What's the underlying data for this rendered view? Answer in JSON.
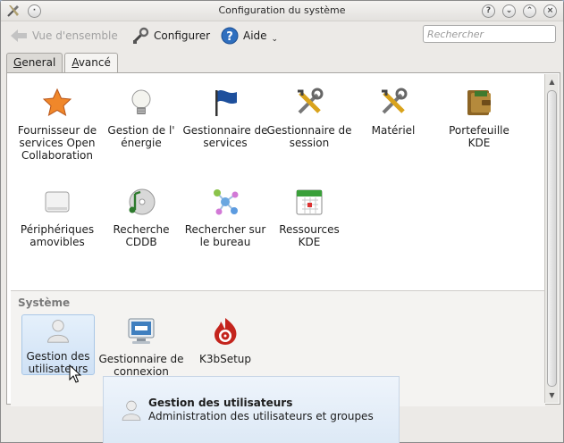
{
  "window": {
    "title": "Configuration du système"
  },
  "toolbar": {
    "overview_label": "Vue d'ensemble",
    "configure_label": "Configurer",
    "help_label": "Aide",
    "search_placeholder": "Rechercher"
  },
  "tabs": [
    {
      "label_prefix": "",
      "label_accel": "G",
      "label_rest": "eneral",
      "active": false
    },
    {
      "label_prefix": "",
      "label_accel": "A",
      "label_rest": "vancé",
      "active": true
    }
  ],
  "items": [
    {
      "label": "Fournisseur de services Open Collaboration",
      "icon": "star-icon"
    },
    {
      "label": "Gestion de l' énergie",
      "icon": "lightbulb-icon"
    },
    {
      "label": "Gestionnaire de services",
      "icon": "flag-icon"
    },
    {
      "label": "Gestionnaire de session",
      "icon": "tools-icon"
    },
    {
      "label": "Matériel",
      "icon": "tools-icon"
    },
    {
      "label": "Portefeuille KDE",
      "icon": "wallet-icon"
    },
    {
      "label": "Périphériques amovibles",
      "icon": "drive-icon"
    },
    {
      "label": "Recherche CDDB",
      "icon": "cd-icon"
    },
    {
      "label": "Rechercher sur le bureau",
      "icon": "nepomuk-icon"
    },
    {
      "label": "Ressources KDE",
      "icon": "calendar-icon"
    }
  ],
  "system_section": {
    "title": "Système",
    "items": [
      {
        "label": "Gestion des utilisateurs",
        "icon": "user-icon"
      },
      {
        "label": "Gestionnaire de connexion",
        "icon": "monitor-icon"
      },
      {
        "label": "K3bSetup",
        "icon": "k3b-icon"
      }
    ]
  },
  "tooltip": {
    "title": "Gestion des utilisateurs",
    "description": "Administration des utilisateurs et groupes"
  }
}
